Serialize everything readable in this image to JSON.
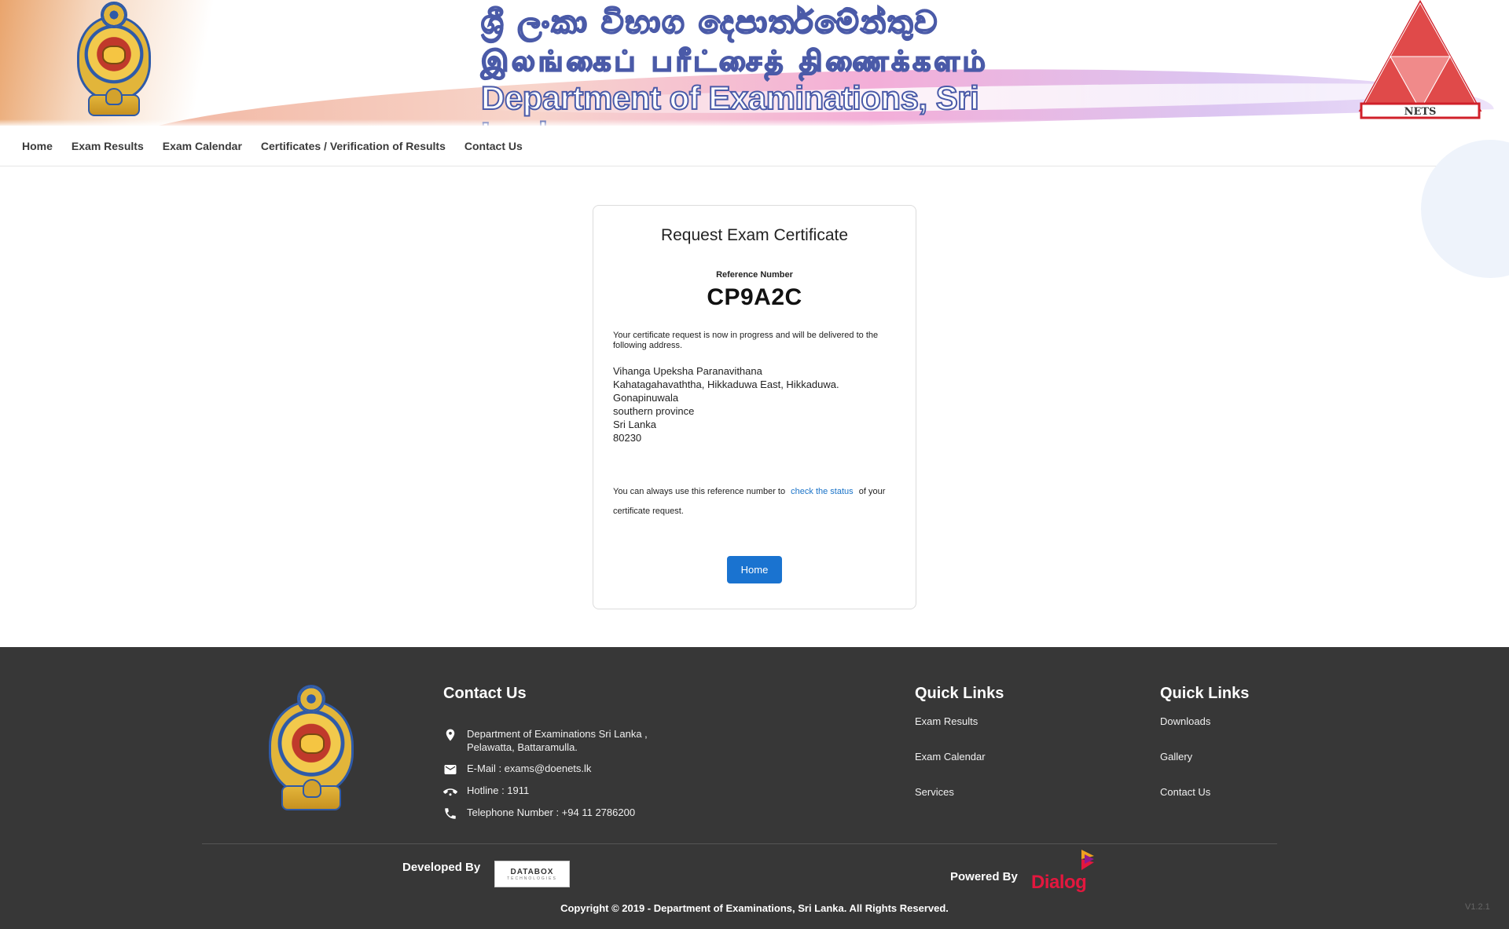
{
  "banner": {
    "title_sinhala": "ශ්‍රී ලංකා විභාග දෙපාර්තමේන්තුව",
    "title_tamil": "இலங்கைப் பரீட்சைத் திணைக்களம்",
    "title_english": "Department of Examinations, Sri Lanka",
    "nets_label": "NETS"
  },
  "nav": {
    "items": [
      {
        "label": "Home"
      },
      {
        "label": "Exam Results"
      },
      {
        "label": "Exam Calendar"
      },
      {
        "label": "Certificates / Verification of Results"
      },
      {
        "label": "Contact Us"
      }
    ]
  },
  "card": {
    "title": "Request Exam Certificate",
    "reference_label": "Reference Number",
    "reference_number": "CP9A2C",
    "message": "Your certificate request is now in progress and will be delivered to the following address.",
    "address": [
      "Vihanga Upeksha Paranavithana",
      "Kahatagahavaththa, Hikkaduwa East, Hikkaduwa.",
      "Gonapinuwala",
      "southern province",
      "Sri Lanka",
      "80230"
    ],
    "status_note_before": "You can always use this reference number to",
    "status_link": "check the status",
    "status_note_after": "of your certificate request.",
    "home_button": "Home"
  },
  "footer": {
    "contact_heading": "Contact Us",
    "contacts": [
      {
        "icon": "location-pin-icon",
        "text_line1": "Department of Examinations Sri Lanka ,",
        "text_line2": "Pelawatta, Battaramulla."
      },
      {
        "icon": "email-icon",
        "text": "E-Mail : exams@doenets.lk"
      },
      {
        "icon": "hotline-icon",
        "text": "Hotline : 1911"
      },
      {
        "icon": "phone-icon",
        "text": "Telephone Number : +94 11 2786200"
      }
    ],
    "quick_links_1": {
      "heading": "Quick Links",
      "links": [
        "Exam Results",
        "Exam Calendar",
        "Services"
      ]
    },
    "quick_links_2": {
      "heading": "Quick Links",
      "links": [
        "Downloads",
        "Gallery",
        "Contact Us"
      ]
    },
    "developed_by": "Developed By",
    "databox_logo": "DATABOX",
    "databox_sub": "TECHNOLOGIES",
    "powered_by": "Powered By",
    "dialog_logo": "Dialog",
    "copyright": "Copyright © 2019 - Department of Examinations, Sri Lanka. All Rights Reserved.",
    "version": "V1.2.1"
  },
  "colors": {
    "primary_button": "#1a73d0",
    "link": "#1a73c8",
    "footer_bg": "#373737",
    "dialog_red": "#e3173e"
  }
}
